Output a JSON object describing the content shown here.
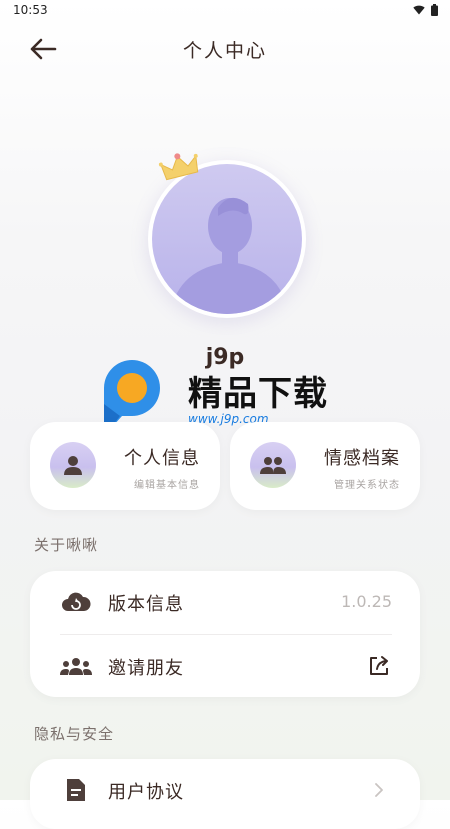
{
  "status_bar": {
    "time": "10:53"
  },
  "header": {
    "title": "个人中心"
  },
  "profile": {
    "username": "j9p"
  },
  "watermark": {
    "brand": "精品下载",
    "url": "www.j9p.com"
  },
  "quick_actions": [
    {
      "title": "个人信息",
      "subtitle": "编辑基本信息",
      "icon": "person-icon"
    },
    {
      "title": "情感档案",
      "subtitle": "管理关系状态",
      "icon": "people-icon"
    }
  ],
  "sections": {
    "about": {
      "label": "关于啾啾",
      "rows": [
        {
          "label": "版本信息",
          "value": "1.0.25",
          "icon": "cloud-refresh-icon"
        },
        {
          "label": "邀请朋友",
          "icon": "group-icon",
          "trailing_icon": "share-icon"
        }
      ]
    },
    "privacy": {
      "label": "隐私与安全",
      "rows": [
        {
          "label": "用户协议",
          "icon": "document-icon",
          "trailing_icon": "chevron-right-icon"
        }
      ]
    }
  },
  "colors": {
    "text": "#3b2a25",
    "accent_purple": "#b8b2ea",
    "muted": "#a9a4a2"
  }
}
